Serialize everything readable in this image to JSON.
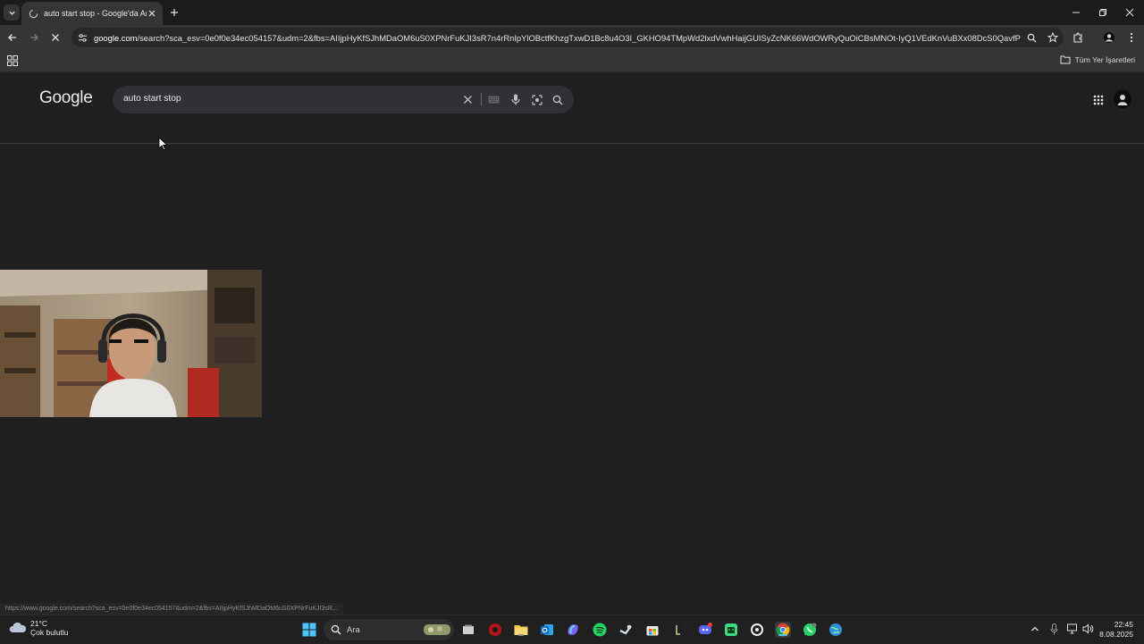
{
  "browser": {
    "tab_title": "auto start stop - Google'da Ara",
    "url_host": "google.com",
    "url_path": "/search?sca_esv=0e0f0e34ec054157&udm=2&fbs=AIIjpHyKfSJhMDaOM6uS0XPNrFuKJI3sR7n4rRnIpYlOBctfKhzgTxwD1Bc8u4O3I_GKHO94TMpWd2lxdVwhHaijGUISyZcNK66WdOWRyQuOiCBsMNOt-IyQ1VEdKnVuBXx08DcS0QavfPB1hMa...",
    "bookmarks_all": "Tüm Yer İşaretleri",
    "status_url": "https://www.google.com/search?sca_esv=0e0f0e34ec054157&udm=2&fbs=AIIjpHyKfSJhMDaOM6uS0XPNrFuKJI3sR..."
  },
  "page": {
    "logo": "Google",
    "search_query": "auto start stop"
  },
  "taskbar": {
    "temperature": "21°C",
    "weather": "Çok bulutlu",
    "search_label": "Ara",
    "time": "22:45",
    "date": "8.08.2025"
  },
  "colors": {
    "page_bg": "#1f1f1f",
    "toolbar_bg": "#353535",
    "searchbox_bg": "#303134",
    "taskbar_bg": "#202020"
  }
}
